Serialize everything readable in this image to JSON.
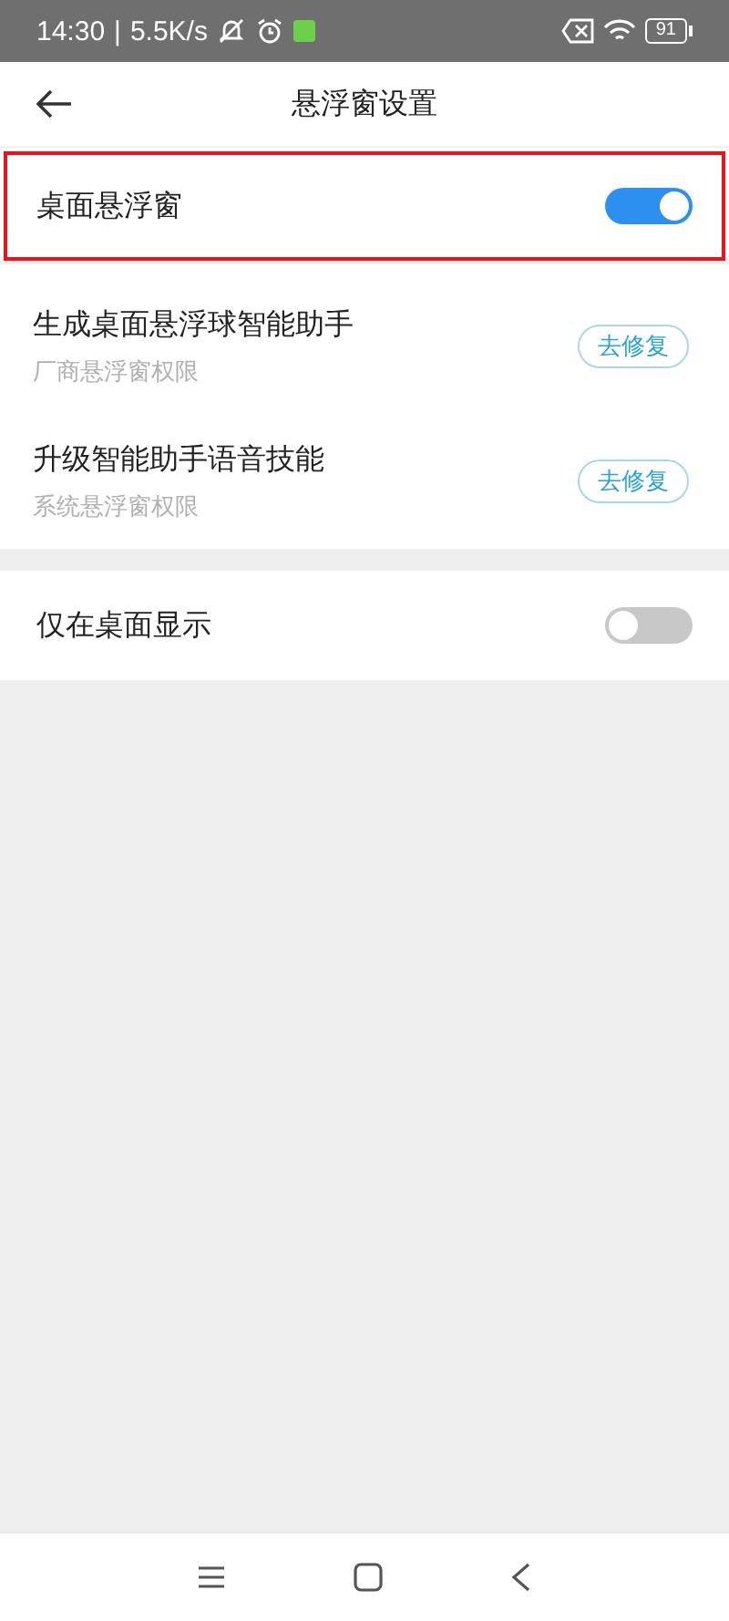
{
  "status_bar": {
    "time": "14:30",
    "separator": "|",
    "speed": "5.5K/s",
    "battery": "91"
  },
  "header": {
    "title": "悬浮窗设置"
  },
  "sections": [
    {
      "items": [
        {
          "kind": "toggle",
          "label": "桌面悬浮窗",
          "on": true,
          "highlighted": true
        }
      ]
    },
    {
      "items": [
        {
          "kind": "fix",
          "label": "生成桌面悬浮球智能助手",
          "sublabel": "厂商悬浮窗权限",
          "button": "去修复"
        },
        {
          "kind": "fix",
          "label": "升级智能助手语音技能",
          "sublabel": "系统悬浮窗权限",
          "button": "去修复"
        }
      ]
    },
    {
      "items": [
        {
          "kind": "toggle",
          "label": "仅在桌面显示",
          "on": false,
          "highlighted": false
        }
      ]
    }
  ]
}
